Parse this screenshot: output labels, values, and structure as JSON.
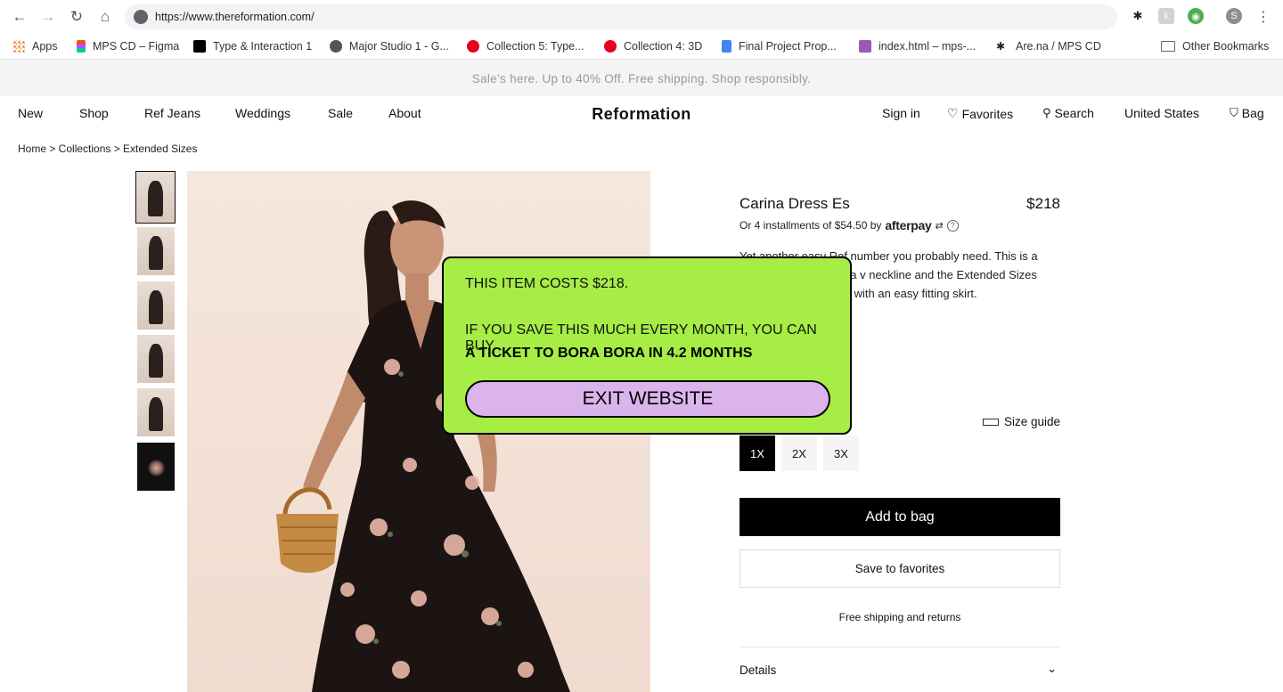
{
  "browser": {
    "url": "https://www.thereformation.com/",
    "profile_initial": "S",
    "bookmarks": [
      {
        "label": "Apps",
        "color": "#e8453c"
      },
      {
        "label": "MPS CD – Figma",
        "color": "#f24e1e"
      },
      {
        "label": "Type & Interaction 1",
        "color": "#000000"
      },
      {
        "label": "Major Studio 1 - G...",
        "color": "#555555"
      },
      {
        "label": "Collection 5: Type...",
        "color": "#e60023"
      },
      {
        "label": "Collection 4: 3D",
        "color": "#e60023"
      },
      {
        "label": "Final Project Prop...",
        "color": "#4285f4"
      },
      {
        "label": "index.html – mps-...",
        "color": "#9b59b6"
      },
      {
        "label": "Are.na / MPS CD",
        "color": "#222222"
      }
    ],
    "other_bookmarks": "Other Bookmarks"
  },
  "promo": "Sale’s here. Up to 40% Off. Free shipping. Shop responsibly.",
  "header": {
    "logo": "Reformation",
    "nav": [
      "New",
      "Shop",
      "Ref Jeans",
      "Weddings",
      "Sale",
      "About"
    ],
    "sign_in": "Sign in",
    "favorites": "Favorites",
    "search": "Search",
    "region": "United States",
    "bag": "Bag"
  },
  "breadcrumb": "Home > Collections > Extended Sizes",
  "product": {
    "name": "Carina Dress Es",
    "price": "$218",
    "installments": "Or 4 installments of $54.50 by",
    "afterpay_logo": "afterpay",
    "description": "Yet another easy Ref number you probably need. This is a dress with a high slit, a v neckline and the Extended Sizes Carina is fitted bodice with an easy fitting skirt.",
    "size_guide": "Size guide",
    "sizes": [
      "1X",
      "2X",
      "3X"
    ],
    "selected_size": "1X",
    "add_to_bag": "Add to bag",
    "save_to_favorites": "Save to favorites",
    "shipping": "Free shipping and returns",
    "details": "Details"
  },
  "popup": {
    "line1": "THIS ITEM COSTS $218.",
    "line2": "IF YOU SAVE THIS MUCH EVERY MONTH, YOU CAN BUY",
    "line3": "A TICKET TO BORA BORA IN 4.2 MONTHS",
    "button": "EXIT WEBSITE",
    "bg_color": "#a6ed45",
    "button_color": "#dcb4ec"
  }
}
